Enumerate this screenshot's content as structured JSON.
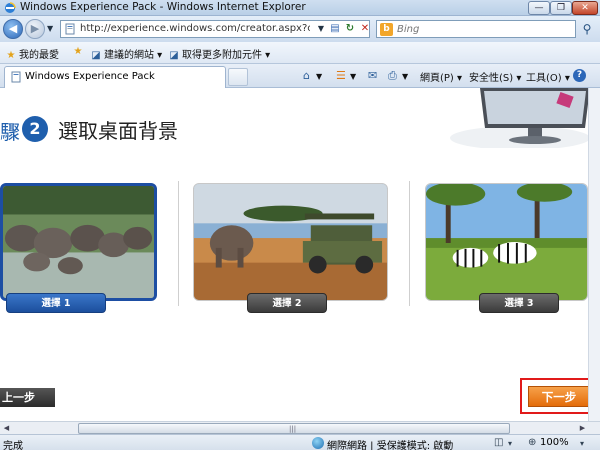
{
  "window": {
    "title": "Windows Experience Pack - Windows Internet Explorer",
    "min_glyph": "—",
    "max_glyph": "❐",
    "close_glyph": "✕"
  },
  "nav": {
    "back_glyph": "◀",
    "forward_glyph": "▶",
    "dropdown_glyph": "▼",
    "url": "http://experience.windows.com/creator.aspx?culture",
    "refresh_glyph": "↻",
    "stop_glyph": "✕",
    "compat_glyph": "▤"
  },
  "search": {
    "engine": "Bing",
    "engine_glyph": "b",
    "placeholder": "Bing",
    "go_glyph": "⚲"
  },
  "favorites": {
    "favorites_label": "我的最愛",
    "suggested_sites": "建議的網站 ▾",
    "more_addons": "取得更多附加元件 ▾"
  },
  "tabs": {
    "active_label": "Windows Experience Pack"
  },
  "commandbar": {
    "page": "網頁(P) ▾",
    "safety": "安全性(S) ▾",
    "tools": "工具(O) ▾",
    "help_glyph": "?",
    "home_glyph": "⌂",
    "feeds_glyph": "☰",
    "mail_glyph": "✉",
    "print_glyph": "⎙"
  },
  "page": {
    "step_fragment": "驟",
    "step_number": "2",
    "title": "選取桌面背景",
    "options": [
      {
        "label": "選擇 1"
      },
      {
        "label": "選擇 2"
      },
      {
        "label": "選擇 3"
      }
    ],
    "prev_label": "上一步",
    "next_label": "下一步"
  },
  "status": {
    "text": "完成",
    "zone": "網際網路 | 受保護模式: 啟動",
    "zoom": "100%",
    "dropdown_glyph": "▾",
    "scroll_left": "◀",
    "scroll_right": "▶",
    "grip": "|||"
  },
  "colors": {
    "accent_blue": "#1f5fad",
    "next_orange": "#e46c0a",
    "highlight_red": "#e11a1a"
  }
}
